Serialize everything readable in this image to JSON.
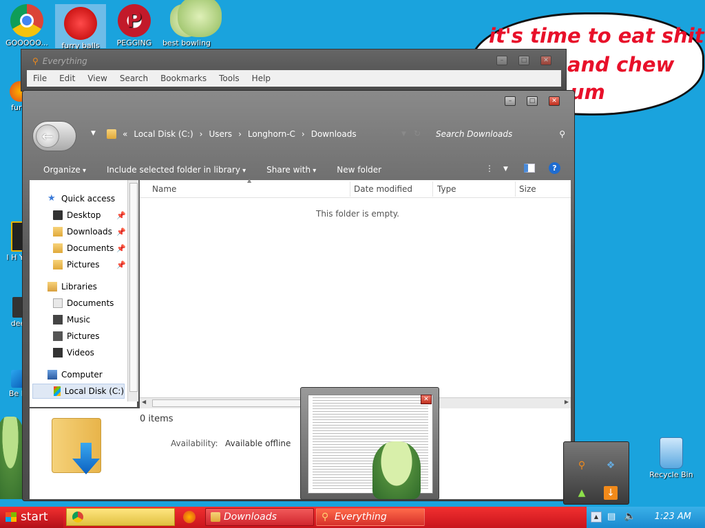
{
  "desktop": {
    "icons": [
      {
        "label": "GOOOOO..."
      },
      {
        "label": "furry balls"
      },
      {
        "label": "PEGGING"
      },
      {
        "label": "best bowling"
      },
      {
        "label": "furr"
      },
      {
        "label": "I H YO"
      },
      {
        "label": "dee"
      },
      {
        "label": "Be D"
      },
      {
        "label": "Recycle Bin"
      }
    ]
  },
  "bubble": {
    "line1": "it's time to eat shit",
    "line2": "and chew",
    "line3": "um"
  },
  "everything_window": {
    "title": "Everything",
    "menu": [
      "File",
      "Edit",
      "View",
      "Search",
      "Bookmarks",
      "Tools",
      "Help"
    ]
  },
  "explorer": {
    "breadcrumb": [
      "«",
      "Local Disk (C:)",
      "Users",
      "Longhorn-C",
      "Downloads"
    ],
    "search_placeholder": "Search Downloads",
    "commands": {
      "organize": "Organize",
      "include": "Include selected folder in library",
      "share": "Share with",
      "new_folder": "New folder"
    },
    "nav": {
      "quick_access": "Quick access",
      "qa_items": [
        "Desktop",
        "Downloads",
        "Documents",
        "Pictures"
      ],
      "libraries": "Libraries",
      "lib_items": [
        "Documents",
        "Music",
        "Pictures",
        "Videos"
      ],
      "computer": "Computer",
      "local_disk": "Local Disk (C:)"
    },
    "columns": [
      "Name",
      "Date modified",
      "Type",
      "Size"
    ],
    "empty_message": "This folder is empty.",
    "details": {
      "count": "0 items",
      "availability_label": "Availability:",
      "availability_value": "Available offline"
    }
  },
  "taskbar": {
    "start": "start",
    "tasks": [
      "Downloads",
      "Everything"
    ],
    "clock": "1:23 AM"
  },
  "colors": {
    "desktop": "#1aa3dd",
    "taskbar": "#e0202a",
    "tray": "#1a8ad0",
    "bubble_text": "#e8102a"
  }
}
